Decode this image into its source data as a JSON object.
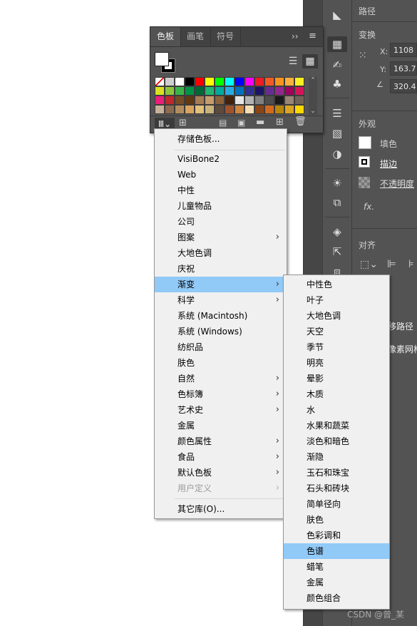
{
  "swatches_panel": {
    "tabs": [
      "色板",
      "画笔",
      "符号"
    ],
    "active_tab": "色板",
    "colors": [
      "#ffffff",
      "#cfcfcf",
      "#ffffff",
      "#000000",
      "#ff0000",
      "#ffff00",
      "#00ff00",
      "#00ffff",
      "#0000ff",
      "#ff00ff",
      "#ed1c24",
      "#f15a24",
      "#f7931e",
      "#fbb03b",
      "#fcee21",
      "#d9e021",
      "#8cc63f",
      "#39b54a",
      "#009245",
      "#006837",
      "#22b573",
      "#00a99d",
      "#29abe2",
      "#0071bc",
      "#2e3192",
      "#1b1464",
      "#662d91",
      "#93278f",
      "#9e005d",
      "#d4145a",
      "#ed1e79",
      "#c1272d",
      "#754c24",
      "#603813",
      "#a67c52",
      "#c69c6d",
      "#8c6239",
      "#42210b",
      "#e6e6e6",
      "#b3b3b3",
      "#808080",
      "#4d4d4d",
      "#1a1a1a",
      "#998675",
      "#736357",
      "#c7b299",
      "#8c6b4f",
      "#b38d5e",
      "#d8a45d",
      "#e3c07a",
      "#c9b27c",
      "#5e4a3a",
      "#a0522d",
      "#cd853f",
      "#f5deb3",
      "#8b4513",
      "#d2691e",
      "#b8860b",
      "#daa520",
      "#ffd700"
    ]
  },
  "library_menu": {
    "items": [
      {
        "label": "存储色板...",
        "submenu": false
      },
      {
        "label": "VisiBone2",
        "submenu": false
      },
      {
        "label": "Web",
        "submenu": false
      },
      {
        "label": "中性",
        "submenu": false
      },
      {
        "label": "儿童物品",
        "submenu": false
      },
      {
        "label": "公司",
        "submenu": false
      },
      {
        "label": "图案",
        "submenu": true
      },
      {
        "label": "大地色调",
        "submenu": false
      },
      {
        "label": "庆祝",
        "submenu": false
      },
      {
        "label": "渐变",
        "submenu": true,
        "highlighted": true
      },
      {
        "label": "科学",
        "submenu": true
      },
      {
        "label": "系统 (Macintosh)",
        "submenu": false
      },
      {
        "label": "系统 (Windows)",
        "submenu": false
      },
      {
        "label": "纺织品",
        "submenu": false
      },
      {
        "label": "肤色",
        "submenu": false
      },
      {
        "label": "自然",
        "submenu": true
      },
      {
        "label": "色标簿",
        "submenu": true
      },
      {
        "label": "艺术史",
        "submenu": true
      },
      {
        "label": "金属",
        "submenu": false
      },
      {
        "label": "颜色属性",
        "submenu": true
      },
      {
        "label": "食品",
        "submenu": true
      },
      {
        "label": "默认色板",
        "submenu": true
      },
      {
        "label": "用户定义",
        "submenu": true,
        "disabled": true
      },
      {
        "label": "其它库(O)...",
        "submenu": false
      }
    ]
  },
  "gradient_submenu": {
    "items": [
      "中性色",
      "叶子",
      "大地色调",
      "天空",
      "季节",
      "明亮",
      "晕影",
      "木质",
      "水",
      "水果和蔬菜",
      "淡色和暗色",
      "渐隐",
      "玉石和珠宝",
      "石头和砖块",
      "简单径向",
      "肤色",
      "色彩调和",
      "色谱",
      "蜡笔",
      "金属",
      "颜色组合"
    ],
    "highlighted": "色谱"
  },
  "right_panel": {
    "path_title": "路径",
    "transform_title": "变换",
    "x_label": "X:",
    "x_value": "1108",
    "y_label": "Y:",
    "y_value": "163.7",
    "angle_value": "320.4",
    "appearance_title": "外观",
    "fill_label": "填色",
    "stroke_label": "描边",
    "opacity_label": "不透明度",
    "fx_label": "fx.",
    "align_title": "对齐",
    "offset_path_label": "移路径",
    "pixel_grid_label": "像素网格"
  },
  "watermark": "CSDN @曾_某"
}
